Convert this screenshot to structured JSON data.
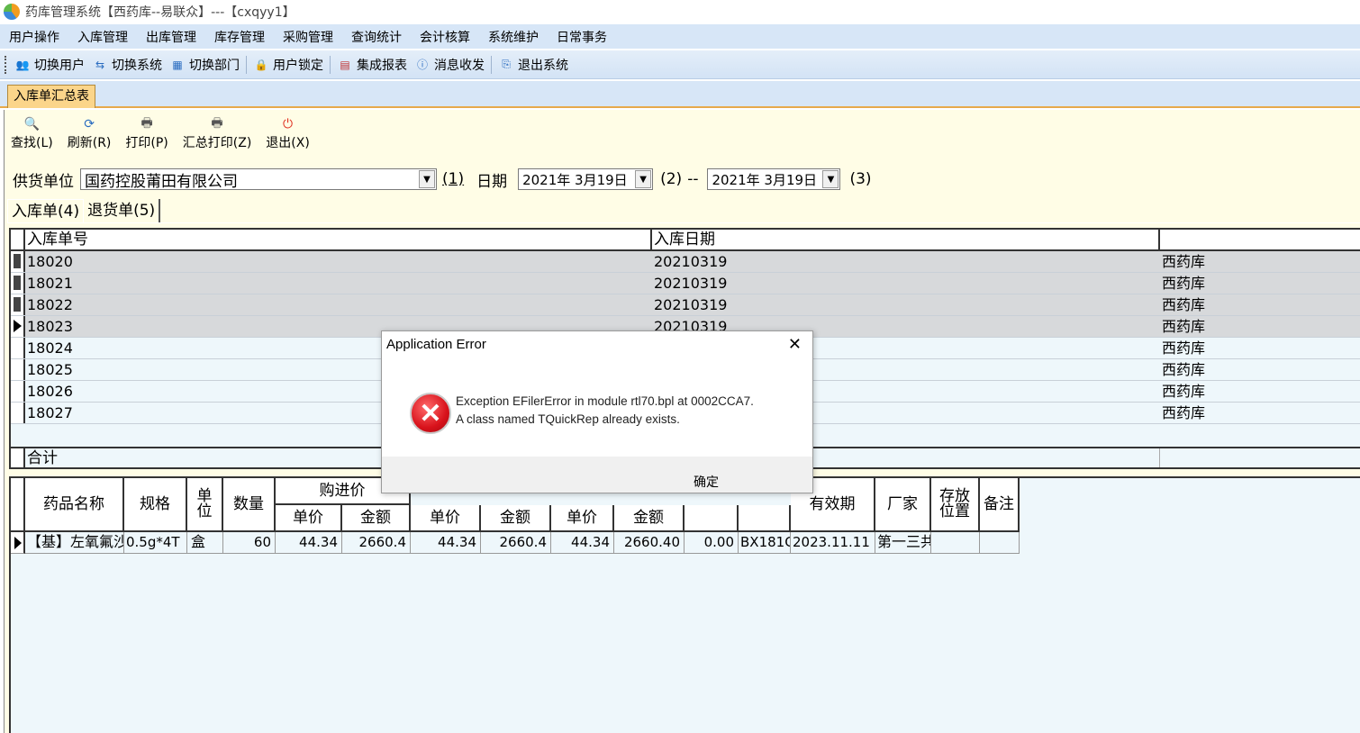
{
  "window": {
    "title": "药库管理系统【西药库--易联众】---【cxqyy1】"
  },
  "menu": [
    "用户操作",
    "入库管理",
    "出库管理",
    "库存管理",
    "采购管理",
    "查询统计",
    "会计核算",
    "系统维护",
    "日常事务"
  ],
  "toolbar": {
    "switch_user": "切换用户",
    "switch_system": "切换系统",
    "switch_dept": "切换部门",
    "lock_user": "用户锁定",
    "report": "集成报表",
    "messages": "消息收发",
    "exit_system": "退出系统"
  },
  "doc_tab": "入库单汇总表",
  "actions": {
    "find": "查找(L)",
    "refresh": "刷新(R)",
    "print": "打印(P)",
    "summary_print": "汇总打印(Z)",
    "exit": "退出(X)"
  },
  "filter": {
    "supplier_label": "供货单位",
    "supplier_value": "国药控股莆田有限公司",
    "hotkey1": "(1)",
    "date_label": "日期",
    "date_from": "2021年  3月19日",
    "hotkey2": "(2)",
    "dash": "--",
    "date_to": "2021年  3月19日",
    "hotkey3": "(3)"
  },
  "subtabs": {
    "inbound": "入库单(4)",
    "returns": "退货单(5)"
  },
  "grid1": {
    "headers": [
      "入库单号",
      "入库日期",
      ""
    ],
    "rows": [
      [
        "18020",
        "20210319",
        "西药库"
      ],
      [
        "18021",
        "20210319",
        "西药库"
      ],
      [
        "18022",
        "20210319",
        "西药库"
      ],
      [
        "18023",
        "20210319",
        "西药库"
      ],
      [
        "18024",
        "",
        "西药库"
      ],
      [
        "18025",
        "",
        "西药库"
      ],
      [
        "18026",
        "",
        "西药库"
      ],
      [
        "18027",
        "",
        "西药库"
      ]
    ],
    "total_label": "合计"
  },
  "grid2": {
    "h_name": "药品名称",
    "h_spec": "规格",
    "h_unit": "单\n位",
    "h_qty": "数量",
    "h_purchase": "购进价",
    "h_unit_price": "单价",
    "h_amount": "金额",
    "h_p2": "单价",
    "h_a2": "金额",
    "h_p3": "单价",
    "h_a3": "金额",
    "h_expiry": "有效期",
    "h_maker": "厂家",
    "h_location": "存放\n位置",
    "h_note": "备注",
    "row": {
      "name": "【基】左氧氟沙",
      "spec": "0.5g*4T",
      "unit": "盒",
      "qty": "60",
      "price1": "44.34",
      "amount1": "2660.4",
      "price2": "44.34",
      "amount2": "2660.4",
      "price3": "44.34",
      "amount3": "2660.40",
      "diff": "0.00",
      "batch": "BX181G",
      "expiry": "2023.11.11",
      "maker": "第一三共"
    }
  },
  "dialog": {
    "title": "Application Error",
    "line1": "Exception EFilerError in module rtl70.bpl at 0002CCA7.",
    "line2": "A class named TQuickRep already exists.",
    "ok": "确定"
  }
}
